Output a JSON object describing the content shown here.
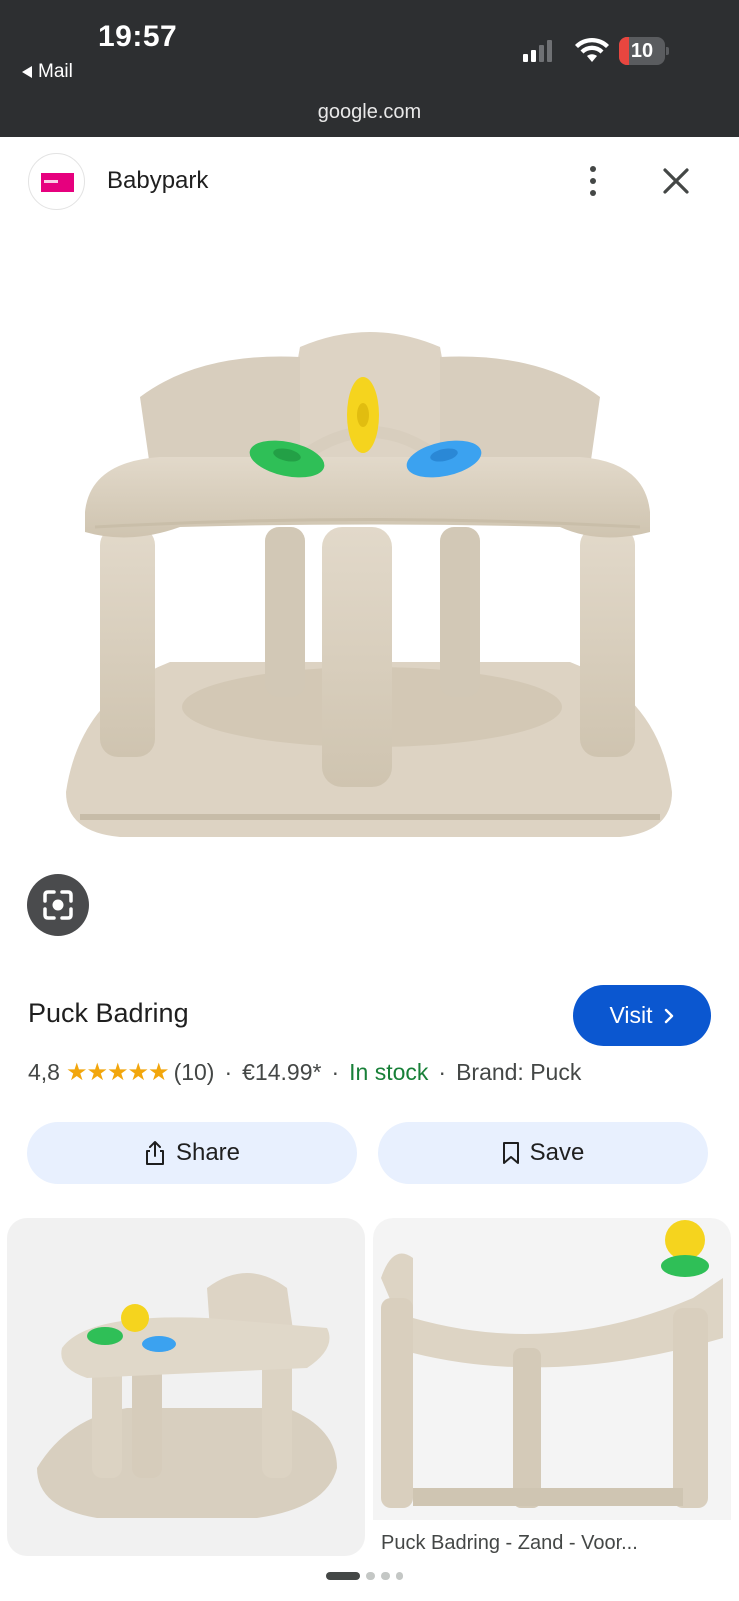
{
  "status_bar": {
    "time": "19:57",
    "back_app_label": "Mail",
    "battery_level": "10",
    "url": "google.com"
  },
  "source": {
    "name": "Babypark",
    "logo_color": "#e6007e",
    "more_icon": "more-vert-icon",
    "close_icon": "close-icon"
  },
  "hero": {
    "image_icon": "product-image",
    "lens_icon": "google-lens-icon"
  },
  "product": {
    "title": "Puck Badring",
    "visit_label": "Visit",
    "rating": "4,8",
    "stars": "★★★★★",
    "rating_value": 4.8,
    "review_count": "(10)",
    "price": "€14.99*",
    "availability": "In stock",
    "brand": "Brand: Puck",
    "separator": "·"
  },
  "actions": {
    "share_label": "Share",
    "save_label": "Save"
  },
  "related": {
    "items": [
      {
        "caption": ""
      },
      {
        "caption": "Puck Badring - Zand - Voor..."
      }
    ]
  },
  "pager": {
    "total": 4,
    "active": 0
  },
  "colors": {
    "accent_blue": "#0b57d0",
    "stock_green": "#188038",
    "star_gold": "#f2a60c",
    "button_tint": "#e8f0fe",
    "status_bar": "#2d2f31"
  }
}
